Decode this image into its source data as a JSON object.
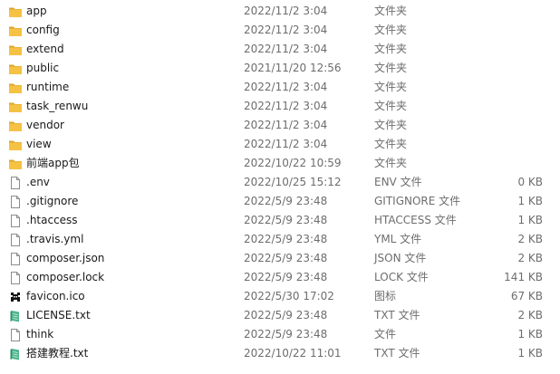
{
  "colors": {
    "folder": "#f6c244",
    "folder_dark": "#dca62a",
    "file_border": "#8c8c8c",
    "text_secondary": "#6d6d6d"
  },
  "files": [
    {
      "name": "app",
      "date": "2022/11/2 3:04",
      "type": "文件夹",
      "size": "",
      "icon": "folder-icon"
    },
    {
      "name": "config",
      "date": "2022/11/2 3:04",
      "type": "文件夹",
      "size": "",
      "icon": "folder-icon"
    },
    {
      "name": "extend",
      "date": "2022/11/2 3:04",
      "type": "文件夹",
      "size": "",
      "icon": "folder-icon"
    },
    {
      "name": "public",
      "date": "2021/11/20 12:56",
      "type": "文件夹",
      "size": "",
      "icon": "folder-icon"
    },
    {
      "name": "runtime",
      "date": "2022/11/2 3:04",
      "type": "文件夹",
      "size": "",
      "icon": "folder-icon"
    },
    {
      "name": "task_renwu",
      "date": "2022/11/2 3:04",
      "type": "文件夹",
      "size": "",
      "icon": "folder-icon"
    },
    {
      "name": "vendor",
      "date": "2022/11/2 3:04",
      "type": "文件夹",
      "size": "",
      "icon": "folder-icon"
    },
    {
      "name": "view",
      "date": "2022/11/2 3:04",
      "type": "文件夹",
      "size": "",
      "icon": "folder-icon"
    },
    {
      "name": "前端app包",
      "date": "2022/10/22 10:59",
      "type": "文件夹",
      "size": "",
      "icon": "folder-icon"
    },
    {
      "name": ".env",
      "date": "2022/10/25 15:12",
      "type": "ENV 文件",
      "size": "0 KB",
      "icon": "file-icon"
    },
    {
      "name": ".gitignore",
      "date": "2022/5/9 23:48",
      "type": "GITIGNORE 文件",
      "size": "1 KB",
      "icon": "file-icon"
    },
    {
      "name": ".htaccess",
      "date": "2022/5/9 23:48",
      "type": "HTACCESS 文件",
      "size": "1 KB",
      "icon": "file-icon"
    },
    {
      "name": ".travis.yml",
      "date": "2022/5/9 23:48",
      "type": "YML 文件",
      "size": "2 KB",
      "icon": "file-icon"
    },
    {
      "name": "composer.json",
      "date": "2022/5/9 23:48",
      "type": "JSON 文件",
      "size": "2 KB",
      "icon": "file-icon"
    },
    {
      "name": "composer.lock",
      "date": "2022/5/9 23:48",
      "type": "LOCK 文件",
      "size": "141 KB",
      "icon": "file-icon"
    },
    {
      "name": "favicon.ico",
      "date": "2022/5/30 17:02",
      "type": "图标",
      "size": "67 KB",
      "icon": "favicon-icon"
    },
    {
      "name": "LICENSE.txt",
      "date": "2022/5/9 23:48",
      "type": "TXT 文件",
      "size": "2 KB",
      "icon": "notepad-icon"
    },
    {
      "name": "think",
      "date": "2022/5/9 23:48",
      "type": "文件",
      "size": "1 KB",
      "icon": "file-icon"
    },
    {
      "name": "搭建教程.txt",
      "date": "2022/10/22 11:01",
      "type": "TXT 文件",
      "size": "1 KB",
      "icon": "notepad-icon"
    }
  ]
}
